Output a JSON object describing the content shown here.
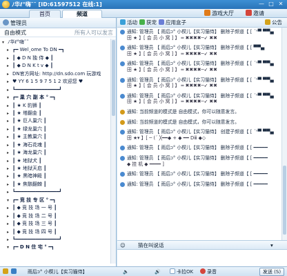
{
  "window": {
    "title": "ﾉ华ℓ°嗨˜˜ [ID:61597512 在线:1]",
    "buttons": {
      "minimize": "—",
      "maximize": "□",
      "close": "✕"
    }
  },
  "tabs": [
    {
      "label": "首页"
    },
    {
      "label": "频道"
    }
  ],
  "top_links": {
    "game_hall": "游戏大厅",
    "invite": "邀请"
  },
  "left": {
    "header": "管理员",
    "mode": "自由模式",
    "mode_hint": "所有人可以发言",
    "rows": [
      {
        "text": "ﾉ华ℓ°嗨˜˜",
        "kind": "root"
      },
      {
        "text": "┏━ Wel¸ome  To  DN  ━┓",
        "kind": "sub"
      },
      {
        "text": "┃   ◆  D  N  独 侍  ◆   ┃",
        "kind": "sub"
      },
      {
        "text": "┃   ◆  D  N  K   t v  ◆   ┃",
        "kind": "sub"
      },
      {
        "text": "DN官方网址: http://dn.sdo.com 玩游戏",
        "kind": "sub"
      },
      {
        "text": "♥  YY 6 1 5 9 7 5 1 2   欢迎您  ♥",
        "kind": "sub"
      },
      {
        "text": "┗━━━━━━━━━━━━━━━┛",
        "kind": "sub"
      },
      {
        "text": "┏━ 巢 穴 副 本 ° ━┓",
        "kind": "cat"
      },
      {
        "text": "┃   ★  K 豹狮   ┃",
        "kind": "sub"
      },
      {
        "text": "┃   ★  塔翻金   ┃",
        "kind": "sub"
      },
      {
        "text": "┃   ★  巨人巢穴  ┃",
        "kind": "sub"
      },
      {
        "text": "┃   ★  绿龙巢穴  ┃",
        "kind": "sub"
      },
      {
        "text": "┃   ★  主教巢穴  ┃",
        "kind": "sub"
      },
      {
        "text": "┃   ★  海石花魂  ┃",
        "kind": "sub"
      },
      {
        "text": "┃   ★  海龙巢穴  ┃",
        "kind": "sub"
      },
      {
        "text": "┃   ★  地狱犬   ┃",
        "kind": "sub"
      },
      {
        "text": "┃   ★  地狱天启  ┃",
        "kind": "sub"
      },
      {
        "text": "┃   ★  黑暗神殿  ┃",
        "kind": "sub"
      },
      {
        "text": "┃   ★  焦骸翻棘  ┃",
        "kind": "sub"
      },
      {
        "text": "┗━━━━━━━━━━━━━━━┛",
        "kind": "sub"
      },
      {
        "text": "┏━ 竞 技 专 区 ° ━┓",
        "kind": "cat"
      },
      {
        "text": "┃ ◆  竞 技 场 一 号  ┃",
        "kind": "sub"
      },
      {
        "text": "┃ ◆  竞 技 场 二 号  ┃",
        "kind": "sub"
      },
      {
        "text": "┃ ◆  竞 技 场 三 号  ┃",
        "kind": "sub"
      },
      {
        "text": "┃ ◆  竞 技 场 四 号  ┃",
        "kind": "sub"
      },
      {
        "text": "┗━━━━━━━━━━━━━━━┛",
        "kind": "sub"
      },
      {
        "text": "┏━ D N 住 宅 ° ━┓",
        "kind": "cat"
      }
    ]
  },
  "right": {
    "toolbar": {
      "activity": "活动",
      "get": "获宠",
      "app_box": "应用盒子",
      "notice": "公告"
    },
    "messages": [
      {
        "l1": "通知: 管理员 【 雨后ↄ° 小楔儿【实习猫侍】 删除子频道【 [ ´ⁿ▀ ▀▀▄",
        "l2": "田 ★      】[  会 员 小 窝  ] 】    ═  ✖✖✖✖─➶ ✖✖"
      },
      {
        "l1": "通知: 管理员 【 雨后ↄ° 小楔儿【实习猫侍】 删除子频道【 [  ▀▀▄",
        "l2": "田 ★      】[  会 员 小 窝  ] 】    ═  ✖✖✖✖─➶ ✖✖"
      },
      {
        "l1": "通知: 管理员 【 雨后ↄ° 小楔儿【实习猫侍】 删除子频道【 [ ´ⁿ▀ ▀▀▄",
        "l2": "田 ★      】[  会 员 小 窝  ] 】    ═  ✖✖✖✖─➶ ✖✖"
      },
      {
        "l1": "通知: 管理员 【 雨后ↄ° 小楔儿【实习猫侍】 删除子频道【 [ ´ⁿ▀ ▀▀▄",
        "l2": "田 ★      】[  会 员 小 窝  ] 】    ═  ✖✖✖✖─➶ ✖✖"
      },
      {
        "l1": "通知: 管理员 【 雨后ↄ° 小楔儿【实习猫侍】 删除子频道【 [ ´ⁿ▀ ▀▀▄",
        "l2": "田 ★      】[  会 员 小 窝  ] 】    ═  ✖✖✖✖─➶ ✖✖"
      },
      {
        "l1": "通知: 当前频道的模式是 自由模式，你可以随意发言。",
        "l2": "",
        "sys": true
      },
      {
        "l1": "通知: 当前频道的模式是 自由模式，你可以随意发言。",
        "l2": "",
        "sys": true
      },
      {
        "l1": "通知: 管理员 【 雨后ↄ° 小楔儿【实习猫侍】 创建子频道【 [ ´ⁿ▀ ▀▀▄",
        "l2": "田 ★▾      】[ ─ (´ ╳━━◆ + ◆ ━━  Dⅲ ◆◇"
      },
      {
        "l1": "通知: 管理员 【 雨后ↄ° 小楔儿【实习猫侍】 删除子频道【 [ ━━━━━",
        "l2": ""
      },
      {
        "l1": "通知: 管理员 【 雨后ↄ° 小楔儿【实习猫侍】 删除子频道【 [ ━━━━━",
        "l2": "    ◆  挂  机  ◆    ━━━━ ]"
      },
      {
        "l1": "通知: 管理员 【 雨后ↄ° 小楔儿【实习猫侍】 删除子频道【 [ ━━━━━",
        "l2": ""
      },
      {
        "l1": "通知: 管理员 【 雨后ↄ° 小楔儿【实习猫侍】 删除子频道【 [ ━━━━━",
        "l2": ""
      }
    ],
    "input_toolbar": {
      "send_to": "猜在叫说话"
    }
  },
  "bottom": {
    "user": "雨后ↄ° 小楔儿【实习猫侍】",
    "volume_a": "",
    "volume_b": "",
    "karaoke": "卡拉OK",
    "record": "录音",
    "send": "发送 (S)"
  }
}
